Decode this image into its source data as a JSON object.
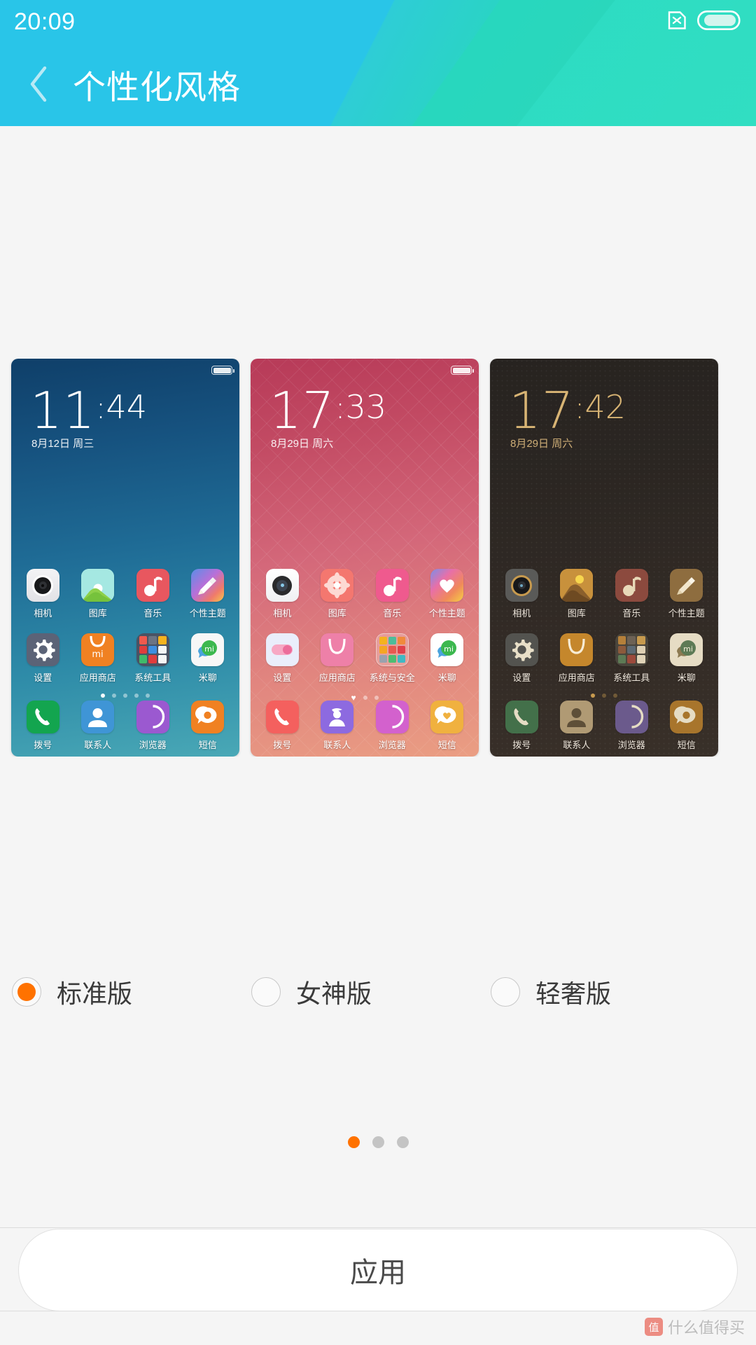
{
  "statusbar": {
    "time": "20:09",
    "nosim_icon": "sim-card-x-icon",
    "battery_icon": "battery-full-icon"
  },
  "header": {
    "back_icon": "chevron-left-icon",
    "title": "个性化风格",
    "gradient_from": "#29c5e8",
    "gradient_to": "#2dd6bd"
  },
  "accent_color": "#ff7200",
  "previews": [
    {
      "id": "standard",
      "clock_hours": "11",
      "clock_separator": ":",
      "clock_minutes": "44",
      "date": "8月12日 周三",
      "wallpaper_class": "wp-standard",
      "page_dots": {
        "count": 5,
        "active": 0,
        "style": "dot"
      },
      "rows": [
        [
          {
            "label": "相机",
            "icon": "camera-icon"
          },
          {
            "label": "图库",
            "icon": "gallery-icon"
          },
          {
            "label": "音乐",
            "icon": "music-note-icon"
          },
          {
            "label": "个性主题",
            "icon": "theme-brush-icon"
          }
        ],
        [
          {
            "label": "设置",
            "icon": "gear-icon"
          },
          {
            "label": "应用商店",
            "icon": "mi-store-bag-icon"
          },
          {
            "label": "系统工具",
            "icon": "system-tools-folder-icon"
          },
          {
            "label": "米聊",
            "icon": "mitalk-icon"
          }
        ]
      ],
      "dock": [
        {
          "label": "拨号",
          "icon": "phone-handset-icon"
        },
        {
          "label": "联系人",
          "icon": "contacts-person-icon"
        },
        {
          "label": "浏览器",
          "icon": "browser-icon"
        },
        {
          "label": "短信",
          "icon": "sms-bubble-icon"
        }
      ]
    },
    {
      "id": "goddess",
      "clock_hours": "17",
      "clock_separator": ":",
      "clock_minutes": "33",
      "date": "8月29日 周六",
      "wallpaper_class": "wp-goddess",
      "page_dots": {
        "count": 3,
        "active": 0,
        "style": "heart"
      },
      "rows": [
        [
          {
            "label": "相机",
            "icon": "camera-icon"
          },
          {
            "label": "图库",
            "icon": "flower-gallery-icon"
          },
          {
            "label": "音乐",
            "icon": "music-note-icon"
          },
          {
            "label": "个性主题",
            "icon": "heart-theme-icon"
          }
        ],
        [
          {
            "label": "设置",
            "icon": "toggle-switch-icon"
          },
          {
            "label": "应用商店",
            "icon": "mi-store-bag-icon"
          },
          {
            "label": "系统与安全",
            "icon": "system-security-folder-icon"
          },
          {
            "label": "米聊",
            "icon": "mitalk-icon"
          }
        ]
      ],
      "dock": [
        {
          "label": "拨号",
          "icon": "phone-handset-icon"
        },
        {
          "label": "联系人",
          "icon": "contacts-lady-icon"
        },
        {
          "label": "浏览器",
          "icon": "browser-icon"
        },
        {
          "label": "短信",
          "icon": "sms-heart-bubble-icon"
        }
      ]
    },
    {
      "id": "luxury",
      "clock_hours": "17",
      "clock_separator": ":",
      "clock_minutes": "42",
      "date": "8月29日 周六",
      "wallpaper_class": "wp-luxury",
      "page_dots": {
        "count": 3,
        "active": 0,
        "style": "dot"
      },
      "rows": [
        [
          {
            "label": "相机",
            "icon": "camera-icon"
          },
          {
            "label": "图库",
            "icon": "sunset-gallery-icon"
          },
          {
            "label": "音乐",
            "icon": "music-note-icon"
          },
          {
            "label": "个性主题",
            "icon": "theme-brush-icon"
          }
        ],
        [
          {
            "label": "设置",
            "icon": "gear-icon"
          },
          {
            "label": "应用商店",
            "icon": "mi-store-bag-icon"
          },
          {
            "label": "系统工具",
            "icon": "system-tools-folder-icon"
          },
          {
            "label": "米聊",
            "icon": "mitalk-icon"
          }
        ]
      ],
      "dock": [
        {
          "label": "拨号",
          "icon": "phone-handset-icon"
        },
        {
          "label": "联系人",
          "icon": "contacts-person-icon"
        },
        {
          "label": "浏览器",
          "icon": "browser-icon"
        },
        {
          "label": "短信",
          "icon": "sms-bubble-icon"
        }
      ]
    }
  ],
  "style_options": [
    {
      "label": "标准版",
      "selected": true
    },
    {
      "label": "女神版",
      "selected": false
    },
    {
      "label": "轻奢版",
      "selected": false
    }
  ],
  "carousel_dots": {
    "count": 3,
    "active": 0
  },
  "apply_button": {
    "label": "应用"
  },
  "watermark": {
    "badge": "值",
    "text": "什么值得买"
  }
}
